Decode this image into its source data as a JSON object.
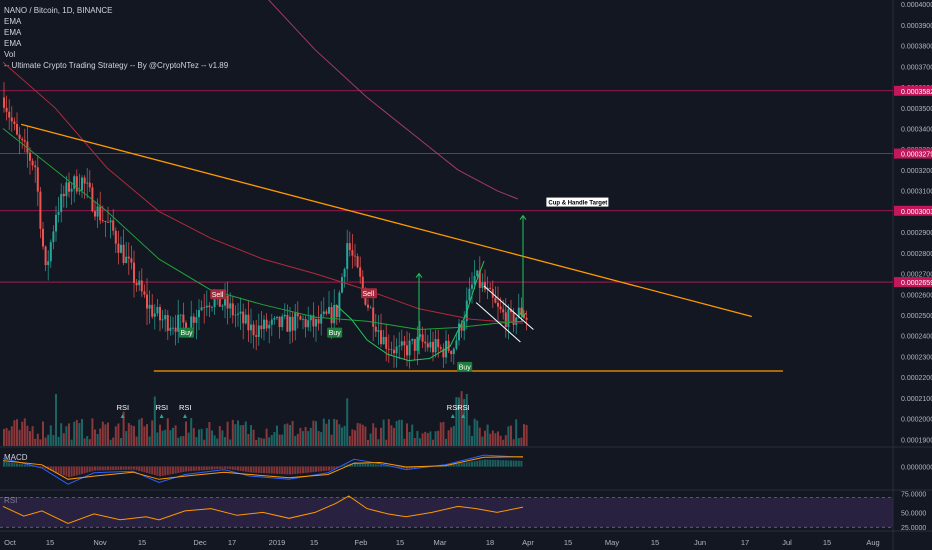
{
  "header": {
    "symbol_title": "NANO / Bitcoin, 1D, BINANCE",
    "indicators": [
      "EMA",
      "EMA",
      "EMA",
      "Vol",
      "-- Ultimate Crypto Trading Strategy -- By @CryptoNTez -- v1.89"
    ]
  },
  "panes": {
    "macd_label": "MACD",
    "rsi_label": "RSI"
  },
  "colors": {
    "background": "#131722",
    "up": "#26a69a",
    "down": "#ef5350",
    "trendline": "#ff9800",
    "level_line": "#c2185b",
    "ema_green": "#1fa13a",
    "ema_red": "#b02a3c",
    "ema_purple": "#a13a6a",
    "pattern_green": "#22c55e",
    "flag_white": "#ffffff",
    "macd_line": "#2962ff",
    "signal_line": "#ff9800",
    "rsi_line": "#ff9800",
    "rsi_band": "#3b2a5a"
  },
  "chart_data": {
    "type": "candlestick",
    "price_axis": {
      "ticks": [
        "0.0003900",
        "0.0003800",
        "0.0003700",
        "0.0003600",
        "0.0003500",
        "0.0003400",
        "0.0003300",
        "0.0003200",
        "0.0003100",
        "0.0003000",
        "0.0002900",
        "0.0002800",
        "0.0002700",
        "0.0002600",
        "0.0002500",
        "0.0002400",
        "0.0002300",
        "0.0002200",
        "0.0002100",
        "0.0002000",
        "0.0001900"
      ],
      "top_value": "0.0004000",
      "range": [
        0.0001868,
        0.000402
      ]
    },
    "x_axis_labels": [
      "Oct",
      "15",
      "Nov",
      "15",
      "Dec",
      "17",
      "2019",
      "15",
      "Feb",
      "15",
      "Mar",
      "18",
      "Apr",
      "15",
      "May",
      "15",
      "Jun",
      "17",
      "Jul",
      "15",
      "Aug"
    ],
    "level_labels": [
      "0.0003582",
      "0.0003279",
      "0.0003003",
      "0.0002659"
    ],
    "levels": [
      0.0003582,
      0.0003279,
      0.0003003,
      0.0002659
    ],
    "annotations": {
      "cup_handle_target": "Cup & Handle Target",
      "signals": [
        {
          "label": "Buy",
          "day": 70,
          "price": 0.0002415
        },
        {
          "label": "Sell",
          "day": 82,
          "price": 0.00026
        },
        {
          "label": "Buy",
          "day": 127,
          "price": 0.0002415
        },
        {
          "label": "Sell",
          "day": 140,
          "price": 0.0002605
        },
        {
          "label": "Buy",
          "day": 177,
          "price": 0.000225
        }
      ],
      "rsi_markers": [
        {
          "label": "RSI",
          "day": 46
        },
        {
          "label": "RSI",
          "day": 61
        },
        {
          "label": "RSI",
          "day": 70
        },
        {
          "label": "RSI",
          "day": 173
        },
        {
          "label": "RSI",
          "day": 177
        }
      ]
    },
    "trendlines": {
      "descending_resistance": {
        "start": {
          "day": 7,
          "price": 0.000342
        },
        "end": {
          "day": 288,
          "price": 0.0002493
        }
      },
      "horizontal_support": {
        "start": {
          "day": 58,
          "price": 0.000223
        },
        "end": {
          "day": 300,
          "price": 0.000223
        }
      }
    },
    "emas": {
      "green": [
        [
          0,
          0.00034
        ],
        [
          20,
          0.00032
        ],
        [
          40,
          0.0003
        ],
        [
          60,
          0.000277
        ],
        [
          80,
          0.000262
        ],
        [
          100,
          0.000255
        ],
        [
          120,
          0.000249
        ],
        [
          140,
          0.000247
        ],
        [
          160,
          0.000243
        ],
        [
          175,
          0.000244
        ],
        [
          190,
          0.000246
        ],
        [
          200,
          0.000247
        ]
      ],
      "red": [
        [
          0,
          0.000372
        ],
        [
          20,
          0.00035
        ],
        [
          40,
          0.000321
        ],
        [
          60,
          0.0003
        ],
        [
          80,
          0.000287
        ],
        [
          100,
          0.000277
        ],
        [
          120,
          0.00027
        ],
        [
          140,
          0.000262
        ],
        [
          160,
          0.000253
        ],
        [
          180,
          0.000248
        ],
        [
          200,
          0.000246
        ]
      ],
      "purple": [
        [
          100,
          0.000405
        ],
        [
          120,
          0.000378
        ],
        [
          140,
          0.000355
        ],
        [
          160,
          0.000335
        ],
        [
          175,
          0.00032
        ],
        [
          190,
          0.00031
        ],
        [
          198,
          0.000306
        ]
      ]
    },
    "macd": {
      "range": [
        -7e-06,
        6e-06
      ],
      "label": "0.0000000",
      "macd_line": [
        [
          0,
          2.5e-06
        ],
        [
          15,
          -5e-07
        ],
        [
          25,
          -5.5e-06
        ],
        [
          35,
          -2e-06
        ],
        [
          50,
          -1.5e-06
        ],
        [
          60,
          -5e-06
        ],
        [
          70,
          -2.5e-06
        ],
        [
          85,
          -1e-06
        ],
        [
          95,
          -3e-06
        ],
        [
          110,
          -4e-06
        ],
        [
          125,
          -2e-06
        ],
        [
          135,
          2.2e-06
        ],
        [
          145,
          8e-07
        ],
        [
          155,
          -1e-06
        ],
        [
          170,
          5e-07
        ],
        [
          185,
          3.5e-06
        ],
        [
          200,
          2.8e-06
        ]
      ],
      "signal_line": [
        [
          0,
          1.8e-06
        ],
        [
          15,
          5e-07
        ],
        [
          25,
          -4e-06
        ],
        [
          35,
          -3e-06
        ],
        [
          50,
          -1.8e-06
        ],
        [
          60,
          -4e-06
        ],
        [
          70,
          -3e-06
        ],
        [
          85,
          -1.8e-06
        ],
        [
          95,
          -2.5e-06
        ],
        [
          110,
          -3.5e-06
        ],
        [
          125,
          -2.5e-06
        ],
        [
          135,
          1e-06
        ],
        [
          145,
          1.2e-06
        ],
        [
          155,
          -2e-07
        ],
        [
          170,
          2e-07
        ],
        [
          185,
          2.8e-06
        ],
        [
          200,
          3e-06
        ]
      ]
    },
    "rsi": {
      "range": [
        25,
        80
      ],
      "labels": [
        "75.0000",
        "50.0000",
        "25.0000"
      ],
      "band": [
        30,
        70
      ],
      "series": [
        [
          0,
          58
        ],
        [
          8,
          45
        ],
        [
          15,
          52
        ],
        [
          25,
          35
        ],
        [
          35,
          48
        ],
        [
          45,
          40
        ],
        [
          55,
          44
        ],
        [
          60,
          40
        ],
        [
          70,
          52
        ],
        [
          80,
          55
        ],
        [
          90,
          46
        ],
        [
          100,
          50
        ],
        [
          110,
          42
        ],
        [
          120,
          50
        ],
        [
          128,
          62
        ],
        [
          133,
          72
        ],
        [
          140,
          55
        ],
        [
          148,
          48
        ],
        [
          155,
          44
        ],
        [
          165,
          50
        ],
        [
          175,
          58
        ],
        [
          182,
          55
        ],
        [
          190,
          50
        ],
        [
          200,
          57
        ]
      ]
    },
    "ohlc_days": 202,
    "first_close": 0.000355,
    "x_axis_scale": {
      "days_per_label_pixels": "axis labels below"
    }
  }
}
